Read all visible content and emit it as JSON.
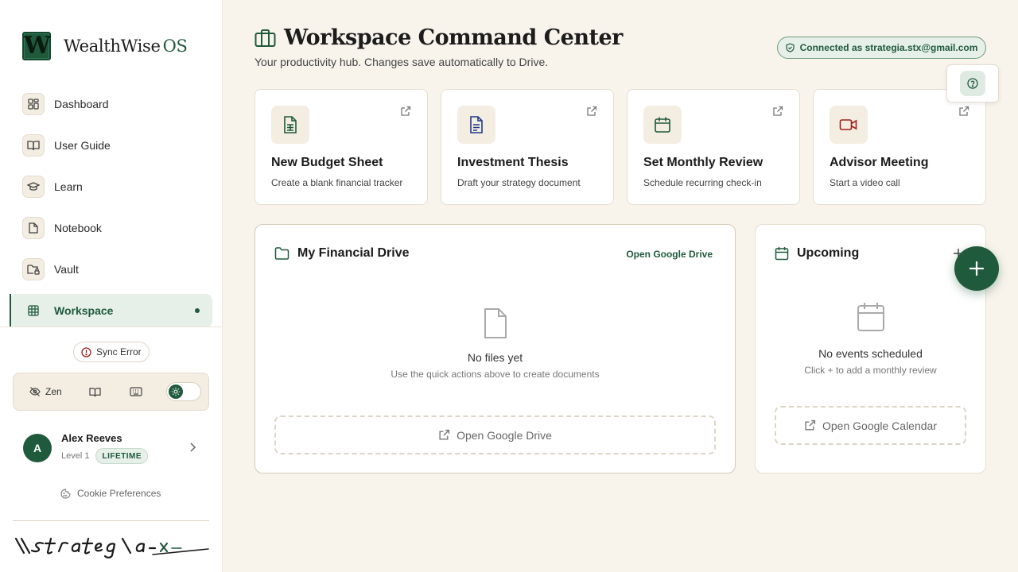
{
  "brand": {
    "logo_letter": "W",
    "name": "WealthWise",
    "suffix": "OS"
  },
  "nav": {
    "items": [
      {
        "label": "Dashboard",
        "icon": "dashboard-grid-icon"
      },
      {
        "label": "User Guide",
        "icon": "book-open-icon"
      },
      {
        "label": "Learn",
        "icon": "graduation-cap-icon"
      },
      {
        "label": "Notebook",
        "icon": "file-icon"
      },
      {
        "label": "Vault",
        "icon": "folder-lock-icon"
      },
      {
        "label": "Workspace",
        "icon": "table-grid-icon",
        "active": true
      }
    ]
  },
  "sync": {
    "label": "Sync Error"
  },
  "toolbar": {
    "zen_label": "Zen",
    "theme_toggle": "on"
  },
  "user": {
    "initial": "A",
    "name": "Alex Reeves",
    "level": "Level 1",
    "badge": "LIFETIME"
  },
  "cookie": {
    "label": "Cookie Preferences"
  },
  "signature": {
    "text": "\\\\strateg\\a-x"
  },
  "header": {
    "title": "Workspace Command Center",
    "subtitle": "Your productivity hub. Changes save automatically to Drive.",
    "connection": "Connected as strategia.stx@gmail.com"
  },
  "quick_actions": [
    {
      "title": "New Budget Sheet",
      "desc": "Create a blank financial tracker",
      "icon": "spreadsheet-icon",
      "color": "#1f5a3c"
    },
    {
      "title": "Investment Thesis",
      "desc": "Draft your strategy document",
      "icon": "document-icon",
      "color": "#1f3a8a"
    },
    {
      "title": "Set Monthly Review",
      "desc": "Schedule recurring check-in",
      "icon": "calendar-icon",
      "color": "#1f5a3c"
    },
    {
      "title": "Advisor Meeting",
      "desc": "Start a video call",
      "icon": "video-icon",
      "color": "#a11d1d"
    }
  ],
  "drive": {
    "title": "My Financial Drive",
    "open_link": "Open Google Drive",
    "empty_title": "No files yet",
    "empty_sub": "Use the quick actions above to create documents",
    "button": "Open Google Drive"
  },
  "upcoming": {
    "title": "Upcoming",
    "empty_title": "No events scheduled",
    "empty_sub": "Click + to add a monthly review",
    "button": "Open Google Calendar"
  },
  "colors": {
    "accent": "#1f5a3c",
    "background": "#f8f4ec",
    "panel": "#ffffff"
  }
}
